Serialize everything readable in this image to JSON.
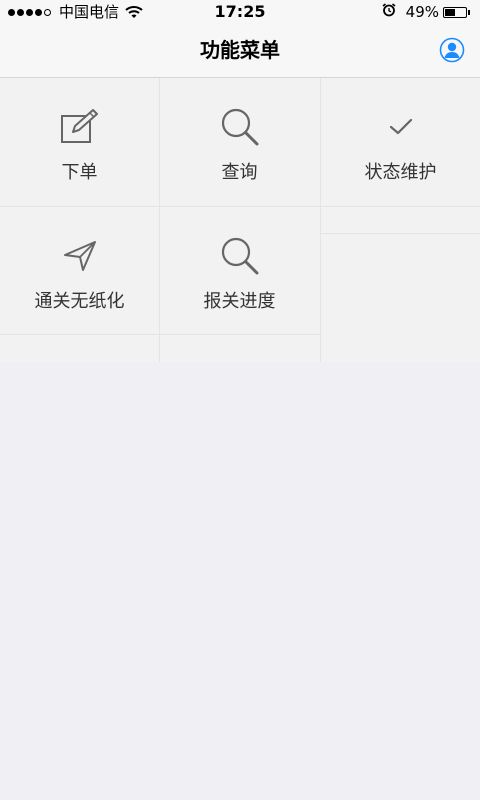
{
  "status_bar": {
    "carrier": "中国电信",
    "time": "17:25",
    "battery_text": "49%",
    "battery_level": 0.49,
    "signal_bars": 4,
    "signal_total": 5
  },
  "nav": {
    "title": "功能菜单",
    "user_icon": "user-icon",
    "accent_color": "#1a8cff"
  },
  "menu": {
    "items": [
      {
        "label": "下单",
        "icon": "edit-icon"
      },
      {
        "label": "查询",
        "icon": "search-icon"
      },
      {
        "label": "状态维护",
        "icon": "check-icon"
      },
      {
        "label": "通关无纸化",
        "icon": "send-icon"
      },
      {
        "label": "报关进度",
        "icon": "search-icon"
      }
    ]
  }
}
